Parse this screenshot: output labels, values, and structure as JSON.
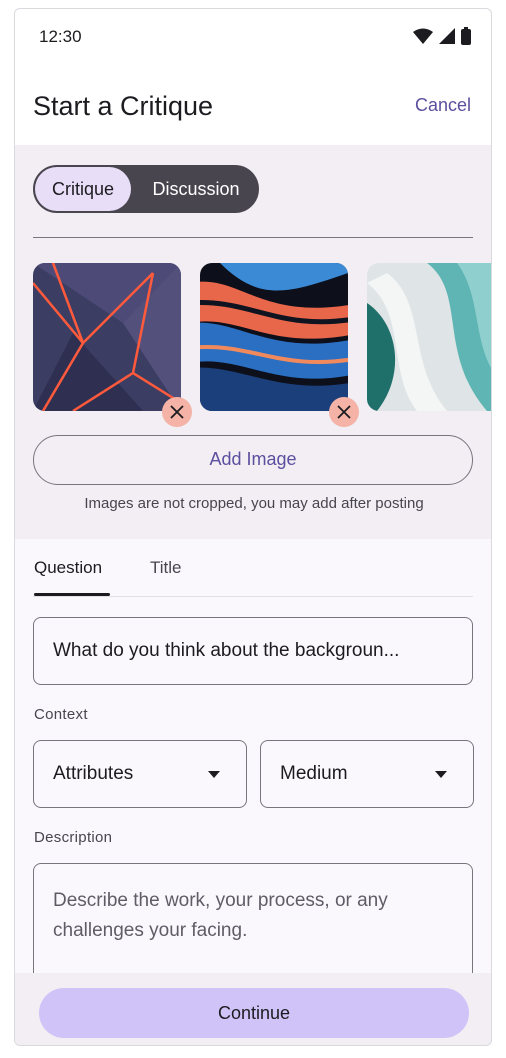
{
  "status_bar": {
    "time": "12:30"
  },
  "header": {
    "title": "Start a Critique",
    "cancel_label": "Cancel"
  },
  "segmented": {
    "options": [
      "Critique",
      "Discussion"
    ],
    "selected": "Critique"
  },
  "images": {
    "items": [
      {
        "name": "abstract-red-geometric"
      },
      {
        "name": "abstract-paint-swirl"
      },
      {
        "name": "abstract-teal-fabric"
      }
    ],
    "add_label": "Add Image",
    "note": "Images are not cropped, you may add after posting"
  },
  "tabs": [
    {
      "label": "Question"
    },
    {
      "label": "Title"
    }
  ],
  "form": {
    "question_value": "What do you think about the backgroun...",
    "context_label": "Context",
    "attributes_value": "Attributes",
    "medium_value": "Medium",
    "description_label": "Description",
    "description_placeholder": "Describe the work, your process, or any challenges your facing."
  },
  "footer": {
    "continue_label": "Continue"
  },
  "colors": {
    "accent": "#5b4f9e",
    "primary_button": "#d0c3f7",
    "remove_badge": "#f4b3a6"
  }
}
